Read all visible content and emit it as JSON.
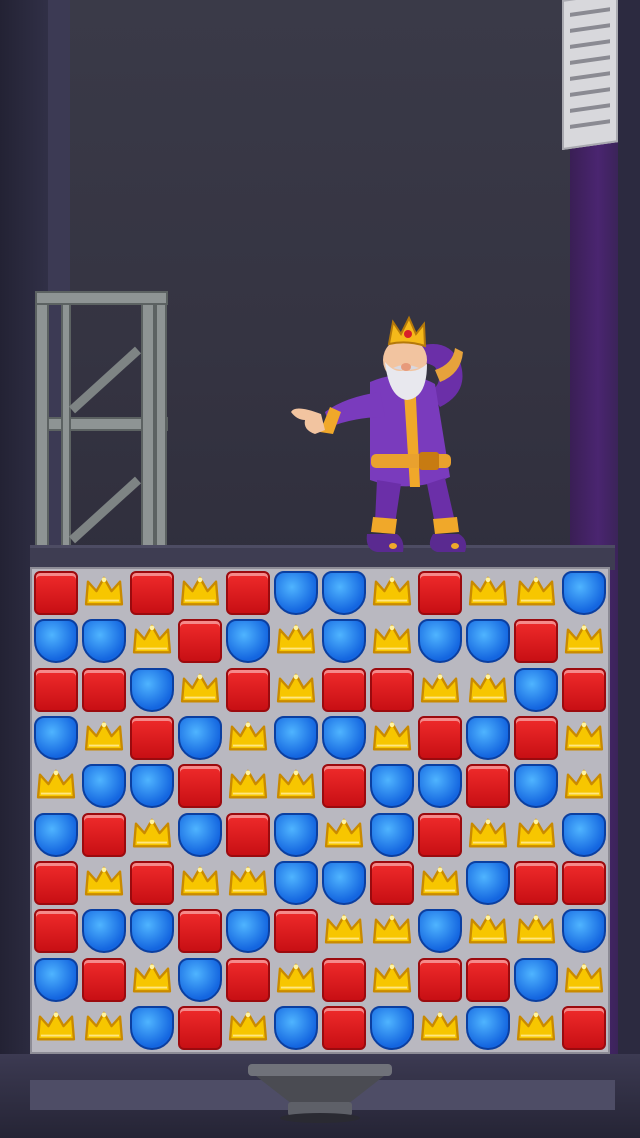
{
  "scene": {
    "name": "royal-match-level",
    "colors": {
      "red": "#e0161b",
      "blue": "#1c6fe8",
      "yellow": "#f7c600",
      "board_bg": "#b9b8c0"
    },
    "icons": {
      "red": "red-square-gem",
      "blue": "blue-shield-gem",
      "yellow": "yellow-crown-gem"
    }
  },
  "board": {
    "rows": 10,
    "cols": 12,
    "grid": [
      [
        "R",
        "Y",
        "R",
        "Y",
        "R",
        "B",
        "B",
        "Y",
        "R",
        "Y",
        "Y",
        "B"
      ],
      [
        "B",
        "B",
        "Y",
        "R",
        "B",
        "Y",
        "B",
        "Y",
        "B",
        "B",
        "R",
        "Y"
      ],
      [
        "R",
        "R",
        "B",
        "Y",
        "R",
        "Y",
        "R",
        "R",
        "Y",
        "Y",
        "B",
        "R"
      ],
      [
        "B",
        "Y",
        "R",
        "B",
        "Y",
        "B",
        "B",
        "Y",
        "R",
        "B",
        "R",
        "Y"
      ],
      [
        "Y",
        "B",
        "B",
        "R",
        "Y",
        "Y",
        "R",
        "B",
        "B",
        "R",
        "B",
        "Y"
      ],
      [
        "B",
        "R",
        "Y",
        "B",
        "R",
        "B",
        "Y",
        "B",
        "R",
        "Y",
        "Y",
        "B"
      ],
      [
        "R",
        "Y",
        "R",
        "Y",
        "Y",
        "B",
        "B",
        "R",
        "Y",
        "B",
        "R",
        "R"
      ],
      [
        "R",
        "B",
        "B",
        "R",
        "B",
        "R",
        "Y",
        "Y",
        "B",
        "Y",
        "Y",
        "B"
      ],
      [
        "B",
        "R",
        "Y",
        "B",
        "R",
        "Y",
        "R",
        "Y",
        "R",
        "R",
        "B",
        "Y"
      ],
      [
        "Y",
        "Y",
        "B",
        "R",
        "Y",
        "B",
        "R",
        "B",
        "Y",
        "B",
        "Y",
        "R"
      ]
    ]
  }
}
